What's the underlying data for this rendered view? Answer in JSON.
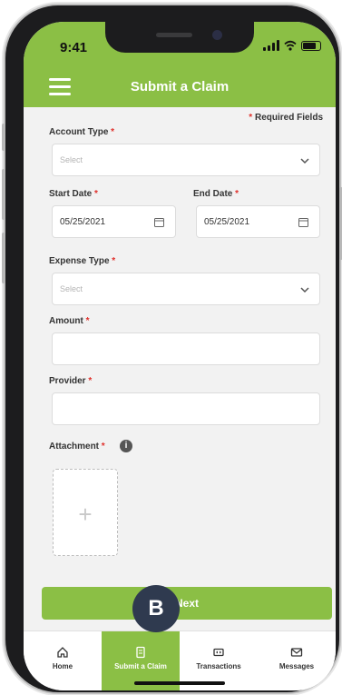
{
  "status_bar": {
    "time": "9:41"
  },
  "header": {
    "title": "Submit a Claim"
  },
  "form": {
    "required_note": "Required Fields",
    "required_marker": "*",
    "account_type": {
      "label": "Account Type",
      "placeholder": "Select"
    },
    "start_date": {
      "label": "Start Date",
      "value": "05/25/2021"
    },
    "end_date": {
      "label": "End Date",
      "value": "05/25/2021"
    },
    "expense_type": {
      "label": "Expense Type",
      "placeholder": "Select"
    },
    "amount": {
      "label": "Amount",
      "value": ""
    },
    "provider": {
      "label": "Provider",
      "value": ""
    },
    "attachment": {
      "label": "Attachment",
      "add_glyph": "+",
      "info_glyph": "i"
    }
  },
  "actions": {
    "next_label": "Next"
  },
  "annotation": {
    "badge": "B"
  },
  "tabbar": {
    "items": [
      {
        "label": "Home",
        "icon": "home-icon",
        "active": false
      },
      {
        "label": "Submit a Claim",
        "icon": "document-icon",
        "active": true
      },
      {
        "label": "Transactions",
        "icon": "transactions-icon",
        "active": false
      },
      {
        "label": "Messages",
        "icon": "mail-icon",
        "active": false
      }
    ]
  },
  "colors": {
    "brand_green": "#8bbf45",
    "required_red": "#e0302b",
    "badge_navy": "#2f3a4f"
  }
}
